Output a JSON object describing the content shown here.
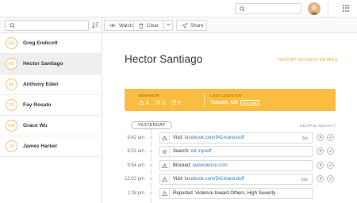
{
  "topbar": {
    "search_placeholder": "",
    "avatar_alt": "user avatar"
  },
  "toolbar": {
    "search_placeholder": "",
    "watch_label": "Watch",
    "clear_label": "Clear",
    "share_label": "Share"
  },
  "sidebar": {
    "people": [
      {
        "initials": "GE",
        "name": "Greg Endicott",
        "selected": false
      },
      {
        "initials": "HS",
        "name": "Hector Santiago",
        "selected": true
      },
      {
        "initials": "AE",
        "name": "Anthony Eden",
        "selected": false
      },
      {
        "initials": "FR",
        "name": "Fay Rosato",
        "selected": false
      },
      {
        "initials": "GW",
        "name": "Grace Wu",
        "selected": false
      },
      {
        "initials": "JH",
        "name": "James Harker",
        "selected": false
      }
    ]
  },
  "main": {
    "title": "Hector Santiago",
    "report_link": "REPORT INCIDENT",
    "details_link": "DETAILS",
    "summary": {
      "behavior_label": "BEHAVIOR",
      "warning_count": "4",
      "block_count": "3",
      "flag_count": "9",
      "location_label": "LAST LOCATION",
      "location": "Tualatin, OR",
      "location_ago": "21m ago"
    },
    "day_label": "YESTERDAY",
    "helpful_label": "HELPFUL RESULT?",
    "events": [
      {
        "time": "9:42 am",
        "icon": "warning-icon",
        "prefix": "Visit: ",
        "link": "facebook.com/541manestuff",
        "duration": "3m"
      },
      {
        "time": "9:53 am",
        "icon": "gear-icon",
        "prefix": "Search: ",
        "link": "kill myself",
        "duration": ""
      },
      {
        "time": "9:54 am",
        "icon": "warning-icon",
        "prefix": "Blocked: ",
        "link": "evilviolence.com",
        "duration": ""
      },
      {
        "time": "12:02 pm",
        "icon": "warning-icon",
        "prefix": "Visit: ",
        "link": "facebook.com/541manestuff",
        "duration": "56s"
      },
      {
        "time": "1:28 pm",
        "icon": "warning-icon",
        "prefix": "Reported: Violence toward Others, High Severity",
        "link": "",
        "duration": ""
      }
    ]
  },
  "colors": {
    "accent": "#fbbd3f",
    "link": "#2f7fc1",
    "orange_text": "#f0a830"
  }
}
